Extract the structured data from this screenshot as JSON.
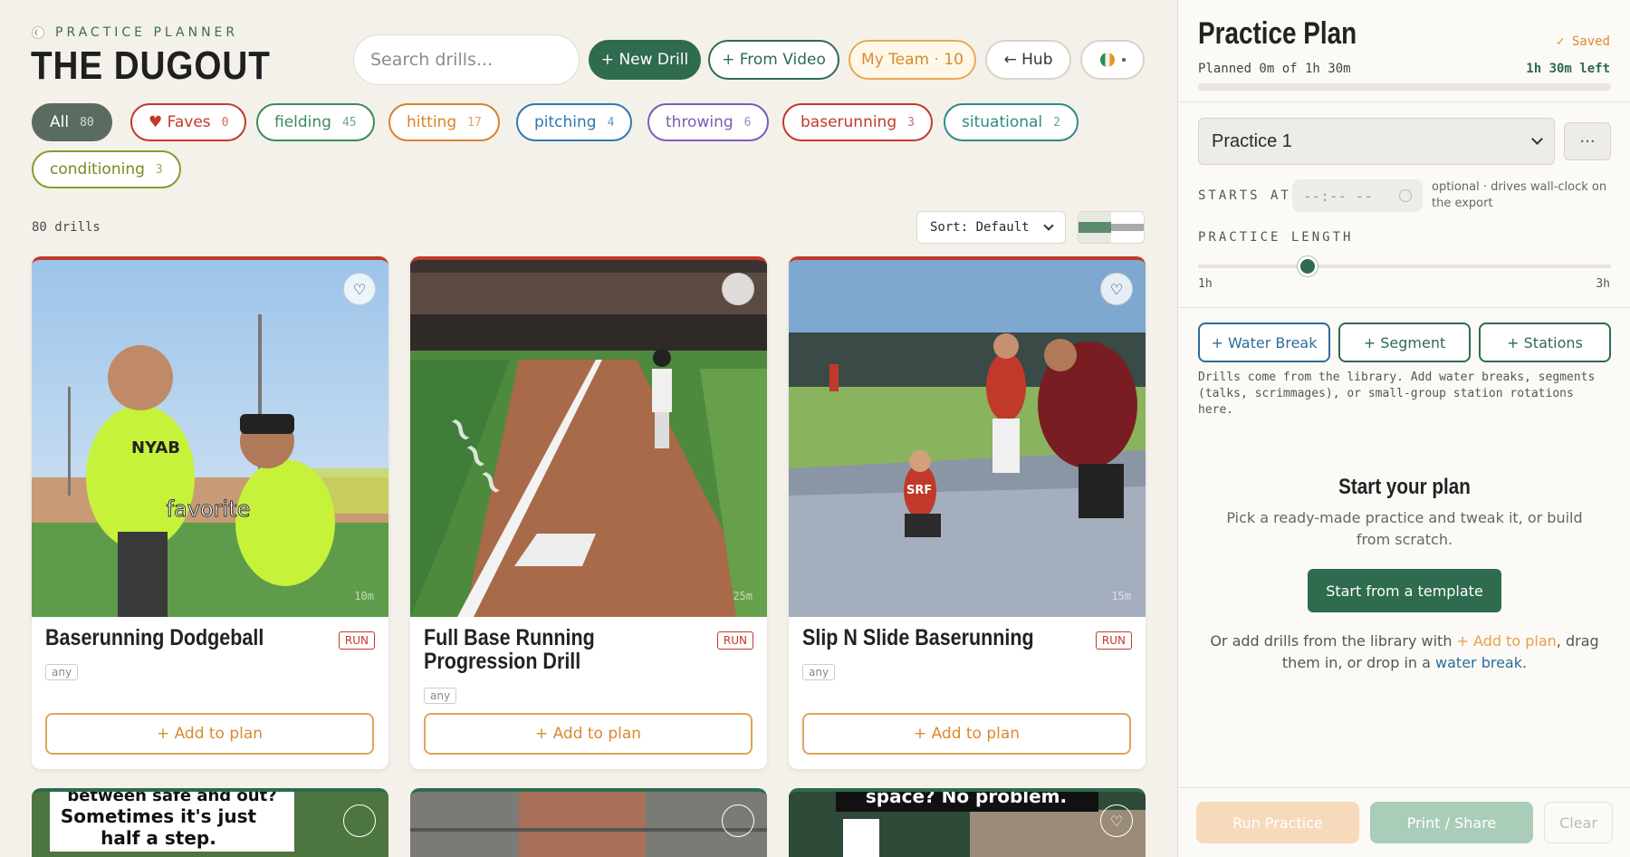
{
  "header": {
    "kicker": "PRACTICE PLANNER",
    "title": "THE DUGOUT",
    "search_placeholder": "Search drills...",
    "new_drill": "+ New Drill",
    "from_video": "+ From Video",
    "my_team": "My Team · 10",
    "hub": "← Hub"
  },
  "filters": [
    {
      "label": "All",
      "count": "80"
    },
    {
      "label": "♥ Faves",
      "count": "0"
    },
    {
      "label": "fielding",
      "count": "45"
    },
    {
      "label": "hitting",
      "count": "17"
    },
    {
      "label": "pitching",
      "count": "4"
    },
    {
      "label": "throwing",
      "count": "6"
    },
    {
      "label": "baserunning",
      "count": "3"
    },
    {
      "label": "situational",
      "count": "2"
    },
    {
      "label": "conditioning",
      "count": "3"
    }
  ],
  "library": {
    "count_text": "80 drills",
    "sort_label": "Sort: Default"
  },
  "cards": [
    {
      "title": "Baserunning Dodgeball",
      "tag": "RUN",
      "level": "any",
      "duration": "10m",
      "overlay_text": "favorite",
      "add": "+ Add to plan"
    },
    {
      "title": "Full Base Running Progression Drill",
      "tag": "RUN",
      "level": "any",
      "duration": "25m",
      "add": "+ Add to plan"
    },
    {
      "title": "Slip N Slide Baserunning",
      "tag": "RUN",
      "level": "any",
      "duration": "15m",
      "add": "+ Add to plan"
    }
  ],
  "row2": {
    "card1_text_a": "between safe and out?",
    "card1_text_b": "Sometimes it's just",
    "card1_text_c": "half a step.",
    "card3_text": "space? No problem."
  },
  "plan": {
    "title": "Practice Plan",
    "saved": "✓ Saved",
    "planned": "Planned 0m of 1h 30m",
    "left": "1h 30m left",
    "progress": 0,
    "practice_name": "Practice 1",
    "more": "···",
    "starts_at_label": "STARTS AT",
    "time_placeholder": "--:-- --",
    "starts_hint": "optional · drives wall-clock on the export",
    "length_label": "PRACTICE LENGTH",
    "length_min": "1h",
    "length_max": "3h",
    "length_value_hours": 1.5,
    "water_break": "+ Water Break",
    "segment": "+ Segment",
    "stations": "+ Stations",
    "help": "Drills come from the library. Add water breaks, segments (talks, scrimmages), or small-group station rotations here.",
    "empty_title": "Start your plan",
    "empty_text": "Pick a ready-made practice and tweak it, or build from scratch.",
    "template_btn": "Start from a template",
    "or_prefix": "Or add drills from the library with ",
    "or_link1": "+ Add to plan",
    "or_mid": ", drag them in, or drop in a ",
    "or_link2": "water break",
    "or_suffix": ".",
    "run": "Run Practice",
    "print": "Print / Share",
    "clear": "Clear"
  },
  "colors": {
    "accent_green": "#2e6b4f",
    "accent_orange": "#d98a2f",
    "run_red": "#c0392b"
  }
}
